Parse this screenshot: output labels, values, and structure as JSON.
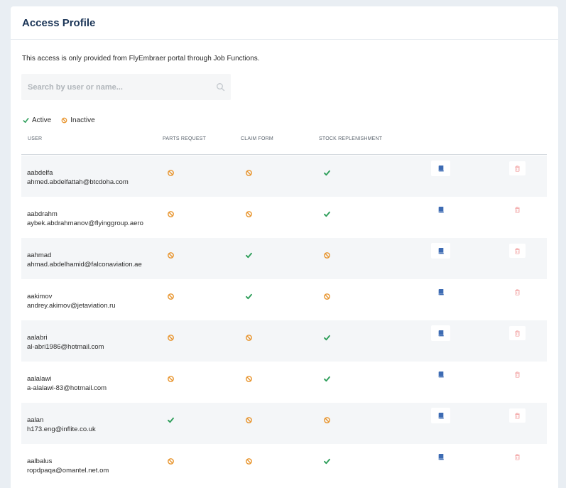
{
  "page": {
    "title": "Access Profile",
    "info": "This access is only provided from FlyEmbraer portal through Job Functions."
  },
  "search": {
    "placeholder": "Search by user or name...",
    "value": ""
  },
  "legend": {
    "active": "Active",
    "inactive": "Inactive"
  },
  "colors": {
    "active": "#2e9e5a",
    "inactive": "#e8952e",
    "edit_icon": "#3d6bb3",
    "delete_icon": "#f2a3a3",
    "title": "#1b3557"
  },
  "table": {
    "columns": [
      "USER",
      "PARTS REQUEST",
      "CLAIM FORM",
      "STOCK REPLENISHMENT"
    ],
    "rows": [
      {
        "username": "aabdelfa",
        "email": "ahmed.abdelfattah@btcdoha.com",
        "parts_request": "inactive",
        "claim_form": "inactive",
        "stock_replenishment": "active"
      },
      {
        "username": "aabdrahm",
        "email": "aybek.abdrahmanov@flyinggroup.aero",
        "parts_request": "inactive",
        "claim_form": "inactive",
        "stock_replenishment": "active"
      },
      {
        "username": "aahmad",
        "email": "ahmad.abdelhamid@falconaviation.ae",
        "parts_request": "inactive",
        "claim_form": "active",
        "stock_replenishment": "inactive"
      },
      {
        "username": "aakimov",
        "email": "andrey.akimov@jetaviation.ru",
        "parts_request": "inactive",
        "claim_form": "active",
        "stock_replenishment": "inactive"
      },
      {
        "username": "aalabri",
        "email": "al-abri1986@hotmail.com",
        "parts_request": "inactive",
        "claim_form": "inactive",
        "stock_replenishment": "active"
      },
      {
        "username": "aalalawi",
        "email": "a-alalawi-83@hotmail.com",
        "parts_request": "inactive",
        "claim_form": "inactive",
        "stock_replenishment": "active"
      },
      {
        "username": "aalan",
        "email": "h173.eng@inflite.co.uk",
        "parts_request": "active",
        "claim_form": "inactive",
        "stock_replenishment": "inactive"
      },
      {
        "username": "aalbalus",
        "email": "ropdpaqa@omantel.net.om",
        "parts_request": "inactive",
        "claim_form": "inactive",
        "stock_replenishment": "active"
      }
    ]
  }
}
